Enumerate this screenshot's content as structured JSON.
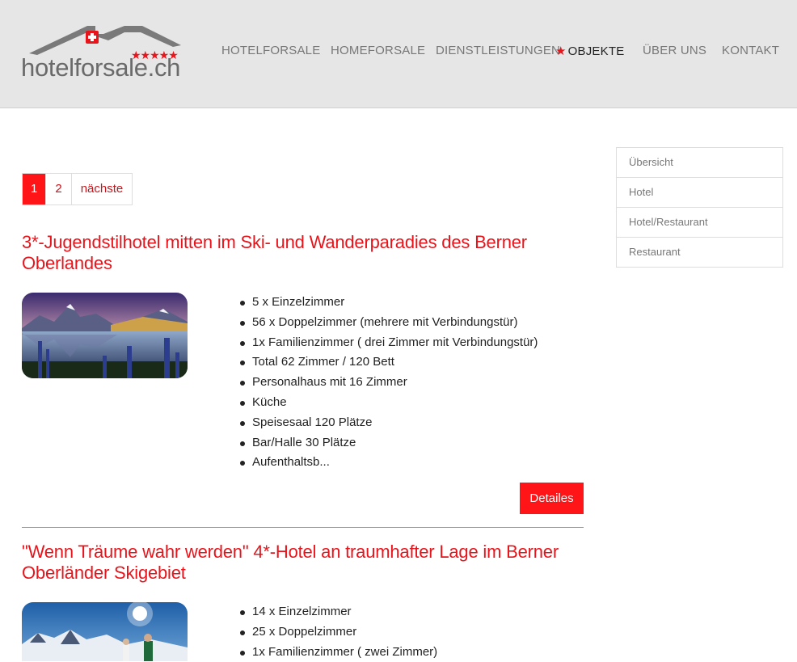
{
  "header": {
    "logo_text": "hotelforsale.ch",
    "nav": {
      "hotelforsale": "HOTELFORSALE",
      "homeforsale": "HOMEFORSALE",
      "dienstleistungen": "DIENSTLEISTUNGEN",
      "objekte": "OBJEKTE",
      "ueber_uns": "ÜBER UNS",
      "kontakt": "KONTAKT"
    },
    "active_marker": "★"
  },
  "pagination": {
    "page1": "1",
    "page2": "2",
    "next": "nächste"
  },
  "listings": [
    {
      "title": "3*-Jugendstilhotel mitten im Ski- und Wanderparadies des Berner Oberlandes",
      "features": [
        "5 x Einzelzimmer",
        "56 x Doppelzimmer (mehrere mit Verbindungstür)",
        "1x Familienzimmer ( drei Zimmer mit Verbindungstür)",
        "Total 62 Zimmer / 120 Bett",
        "Personalhaus mit 16 Zimmer",
        "Küche",
        "Speisesaal 120 Plätze",
        "Bar/Halle 30 Plätze",
        "Aufenthaltsb..."
      ],
      "details_label": "Detailes"
    },
    {
      "title": "\"Wenn Träume wahr werden\" 4*-Hotel an traumhafter Lage im Berner Oberländer Skigebiet",
      "features": [
        "14 x Einzelzimmer",
        "25 x Doppelzimmer",
        "1x Familienzimmer ( zwei Zimmer)"
      ]
    }
  ],
  "sidebar": {
    "items": [
      "Übersicht",
      "Hotel",
      "Hotel/Restaurant",
      "Restaurant"
    ]
  },
  "colors": {
    "accent": "#ff1418",
    "title_red": "#e8141b",
    "header_bg": "#e6e6e6"
  }
}
